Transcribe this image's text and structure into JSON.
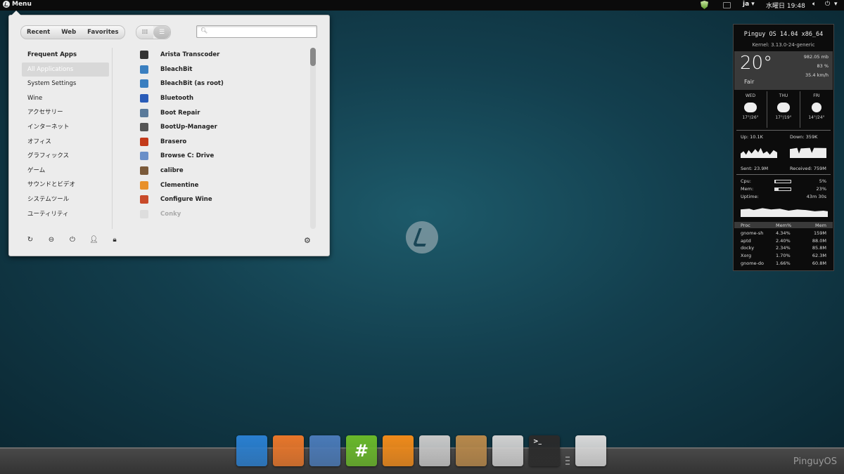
{
  "topbar": {
    "menu_label": "Menu",
    "lang": "ja ▾",
    "clock": "水曜日 19:48",
    "volume_icon": "volume-icon",
    "power_icon": "power-icon",
    "power_arrow": "▾"
  },
  "menu": {
    "tabs": [
      "Recent",
      "Web",
      "Favorites"
    ],
    "search": {
      "value": "",
      "placeholder": ""
    },
    "categories": [
      "Frequent Apps",
      "All Applications",
      "System Settings",
      "Wine",
      "アクセサリー",
      "インターネット",
      "オフィス",
      "グラフィックス",
      "ゲーム",
      "サウンドとビデオ",
      "システムツール",
      "ユーティリティ"
    ],
    "apps": [
      {
        "name": "Arista Transcoder",
        "icon_color": "#333333"
      },
      {
        "name": "BleachBit",
        "icon_color": "#3a7fc0"
      },
      {
        "name": "BleachBit (as root)",
        "icon_color": "#3a7fc0"
      },
      {
        "name": "Bluetooth",
        "icon_color": "#2a5cb8"
      },
      {
        "name": "Boot Repair",
        "icon_color": "#5a7a9a"
      },
      {
        "name": "BootUp-Manager",
        "icon_color": "#555555"
      },
      {
        "name": "Brasero",
        "icon_color": "#c33a1a"
      },
      {
        "name": "Browse C: Drive",
        "icon_color": "#6a8fc8"
      },
      {
        "name": "calibre",
        "icon_color": "#7a5a3a"
      },
      {
        "name": "Clementine",
        "icon_color": "#e8902a"
      },
      {
        "name": "Configure Wine",
        "icon_color": "#c84a2a"
      },
      {
        "name": "Conky",
        "icon_color": "#dddddd"
      }
    ]
  },
  "conky": {
    "title": "Pinguy OS 14.04 x86_64",
    "kernel": "Kernel: 3.13.0-24-generic",
    "temp": "20°",
    "condition": "Fair",
    "pressure": "982.05 mb",
    "humidity": "83 %",
    "wind": "35.4 km/h",
    "days": [
      {
        "name": "WED",
        "temps": "17°/26°"
      },
      {
        "name": "THU",
        "temps": "17°/19°"
      },
      {
        "name": "FRI",
        "temps": "14°/24°"
      }
    ],
    "up": "Up: 10.1K",
    "down": "Down: 359K",
    "sent": "Sent: 23.9M",
    "received": "Received: 759M",
    "cpu_label": "Cpu:",
    "cpu_val": "5%",
    "cpu_level": 0.05,
    "mem_label": "Mem:",
    "mem_val": "23%",
    "mem_level": 0.23,
    "uptime_label": "Uptime:",
    "uptime_val": "43m 30s",
    "proc_headers": [
      "Proc",
      "Mem%",
      "Mem"
    ],
    "procs": [
      [
        "gnome-sh",
        "4.34%",
        "159M"
      ],
      [
        "aptd",
        "2.40%",
        "88.0M"
      ],
      [
        "docky",
        "2.34%",
        "85.8M"
      ],
      [
        "Xorg",
        "1.70%",
        "62.3M"
      ],
      [
        "gnome-do",
        "1.66%",
        "60.8M"
      ]
    ]
  },
  "dock": {
    "items": [
      {
        "name": "anchor-icon",
        "color": "#2a7fd0"
      },
      {
        "name": "firefox-icon",
        "color": "#e8762a"
      },
      {
        "name": "mail-stamp-icon",
        "color": "#4a7ab8"
      },
      {
        "name": "hashtag-chat-icon",
        "color": "#6ab82a"
      },
      {
        "name": "orange-slice-icon",
        "color": "#f08a1a"
      },
      {
        "name": "clapperboard-icon",
        "color": "#c8c8c8"
      },
      {
        "name": "package-box-icon",
        "color": "#b8884a"
      },
      {
        "name": "mixer-settings-icon",
        "color": "#d0d0d0"
      },
      {
        "name": "terminal-icon",
        "color": "#2a2a2a"
      },
      {
        "name": "trash-icon",
        "color": "#d8d8d8"
      }
    ],
    "hash_glyph": "#",
    "terminal_glyph": ">_"
  },
  "branding": "PinguyOS"
}
